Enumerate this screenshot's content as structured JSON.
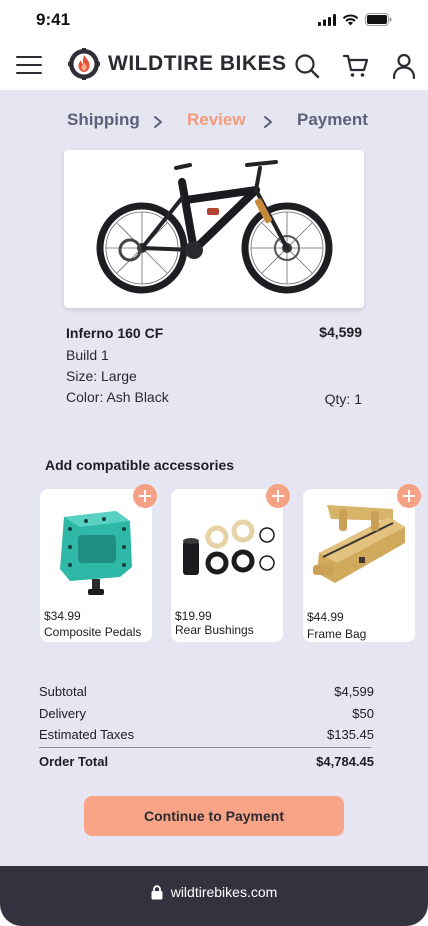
{
  "status": {
    "time": "9:41"
  },
  "brand": {
    "name": "WILDTIRE BIKES",
    "accent": "#f5a286"
  },
  "steps": [
    {
      "label": "Shipping"
    },
    {
      "label": "Review"
    },
    {
      "label": "Payment"
    }
  ],
  "product": {
    "name": "Inferno 160 CF",
    "price": "$4,599",
    "build": "Build 1",
    "size": "Size: Large",
    "color": "Color: Ash Black",
    "qty": "Qty: 1"
  },
  "accessories": {
    "title": "Add compatible accessories",
    "items": [
      {
        "price": "$34.99",
        "name": "Composite Pedals"
      },
      {
        "price": "$19.99",
        "name": "Rear Bushings"
      },
      {
        "price": "$44.99",
        "name": "Frame Bag"
      }
    ]
  },
  "summary": {
    "subtotal_label": "Subtotal",
    "subtotal": "$4,599",
    "delivery_label": "Delivery",
    "delivery": "$50",
    "taxes_label": "Estimated Taxes",
    "taxes": "$135.45",
    "total_label": "Order Total",
    "total": "$4,784.45"
  },
  "cta": {
    "label": "Continue to Payment"
  },
  "browser": {
    "url": "wildtirebikes.com"
  },
  "icons": [
    "menu-icon",
    "brand-logo-icon",
    "search-icon",
    "cart-icon",
    "user-icon",
    "lock-icon",
    "plus-icon",
    "chevron-right-icon"
  ]
}
